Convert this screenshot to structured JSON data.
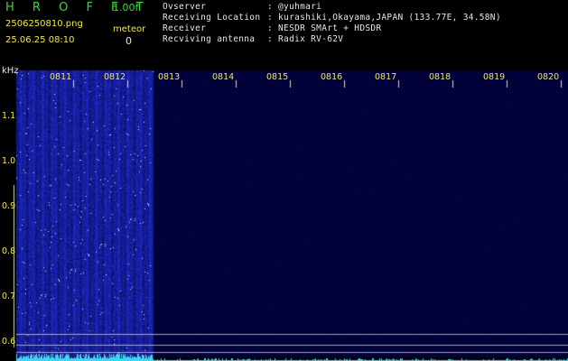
{
  "header": {
    "brand": "H R O F F T",
    "version": "1.00f",
    "filename": "2506250810.png",
    "timestamp": "25.06.25 08:10",
    "meteor_label": "meteor",
    "meteor_count": "0"
  },
  "station_info": [
    {
      "key": "Ovserver",
      "value": ": @yuhmari"
    },
    {
      "key": "Receiving Location",
      "value": ": kurashiki,Okayama,JAPAN (133.77E, 34.58N)"
    },
    {
      "key": "Receiver",
      "value": ": NESDR SMArt + HDSDR"
    },
    {
      "key": "Recviving antenna",
      "value": ": Radix RV-62V"
    }
  ],
  "axis": {
    "unit": "kHz",
    "freq_ticks": [
      "1.1",
      "1.0",
      "0.9",
      "0.8",
      "0.7",
      "0.6"
    ],
    "time_ticks": [
      "0811",
      "0812",
      "0813",
      "0814",
      "0815",
      "0816",
      "0817",
      "0818",
      "0819",
      "0820"
    ]
  },
  "colors": {
    "label_yellow": "#f2ea3c",
    "label_green": "#39d639",
    "info_white": "#e6e6e6",
    "signal_blue": "#2a3cd8",
    "trace_cyan": "#38d8f0",
    "background": "#000000"
  }
}
